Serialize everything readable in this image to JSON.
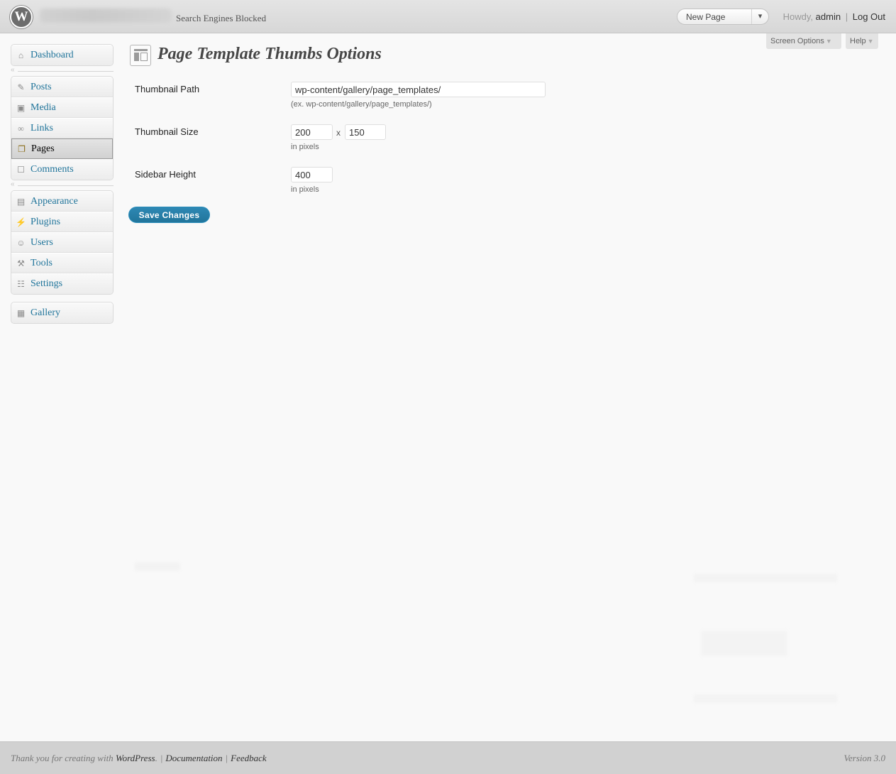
{
  "header": {
    "logo_letter": "W",
    "privacy_status": "Search Engines Blocked",
    "favorite_action": "New Page",
    "favorite_toggle": "▾",
    "howdy": "Howdy,",
    "user": "admin",
    "logout": "Log Out"
  },
  "screen_meta": {
    "screen_options": "Screen Options",
    "help": "Help"
  },
  "menu": {
    "dashboard": "Dashboard",
    "posts": "Posts",
    "media": "Media",
    "links": "Links",
    "pages": "Pages",
    "comments": "Comments",
    "appearance": "Appearance",
    "plugins": "Plugins",
    "users": "Users",
    "tools": "Tools",
    "settings": "Settings",
    "gallery": "Gallery",
    "collapse_arrow": "«"
  },
  "main": {
    "title": "Page Template Thumbs Options",
    "thumbnail_path": {
      "label": "Thumbnail Path",
      "value": "wp-content/gallery/page_templates/",
      "description": "(ex. wp-content/gallery/page_templates/)"
    },
    "thumbnail_size": {
      "label": "Thumbnail Size",
      "width": "200",
      "separator": "x",
      "height": "150",
      "description": "in pixels"
    },
    "sidebar_height": {
      "label": "Sidebar Height",
      "value": "400",
      "description": "in pixels"
    },
    "save_button": "Save Changes"
  },
  "footer": {
    "thanks_prefix": "Thank you for creating with",
    "wordpress_link": "WordPress",
    "documentation": "Documentation",
    "feedback": "Feedback",
    "version": "Version 3.0"
  }
}
